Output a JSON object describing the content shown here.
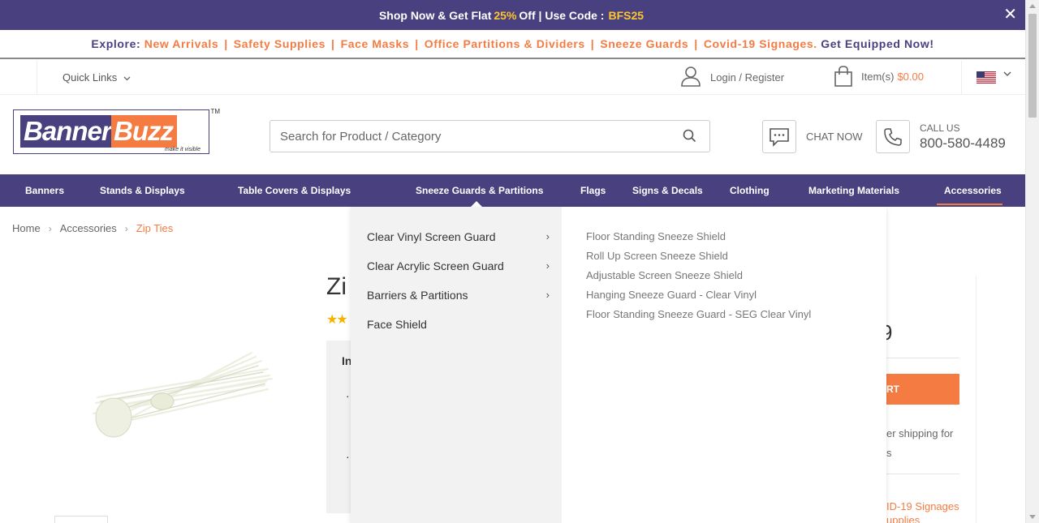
{
  "promo": {
    "prefix": "Shop Now & Get Flat",
    "percent": "25%",
    "middle": "Off | Use Code :",
    "code": "BFS25",
    "close": "✕"
  },
  "explore": {
    "label": "Explore:",
    "links": [
      "New Arrivals",
      "Safety Supplies",
      "Face Masks",
      "Office Partitions & Dividers",
      "Sneeze Guards",
      "Covid-19 Signages"
    ],
    "separator": "|",
    "dot": ".",
    "cta": "Get Equipped Now!"
  },
  "util": {
    "quick_links": "Quick Links",
    "login": "Login / Register",
    "cart_label": "Item(s)",
    "cart_amount": "$0.00"
  },
  "header": {
    "logo_part1": "Banner",
    "logo_part2": "Buzz",
    "logo_tagline": "make it visible",
    "logo_tm": "TM",
    "search_placeholder": "Search for Product / Category",
    "chat_label": "CHAT NOW",
    "call_label": "CALL US",
    "call_number": "800-580-4489"
  },
  "nav": {
    "items": [
      "Banners",
      "Stands & Displays",
      "Table Covers & Displays",
      "Sneeze Guards & Partitions",
      "Flags",
      "Signs & Decals",
      "Clothing",
      "Marketing Materials",
      "Accessories"
    ]
  },
  "breadcrumb": {
    "items": [
      "Home",
      "Accessories",
      "Zip Ties"
    ],
    "sep": "›"
  },
  "product": {
    "title_fragment": "Zi",
    "stars": "★★",
    "info_fragment": "In",
    "bullet": "·",
    "price_fragment": "9",
    "cart_fragment": "RT",
    "shipping_fragment1": "er shipping for",
    "shipping_fragment2": "s",
    "covid_fragment1": "ID-19 Signages",
    "covid_fragment2": "upplies"
  },
  "mega_menu": {
    "sub_categories": [
      {
        "label": "Clear Vinyl Screen Guard",
        "has_children": true
      },
      {
        "label": "Clear Acrylic Screen Guard",
        "has_children": true
      },
      {
        "label": "Barriers & Partitions",
        "has_children": true
      },
      {
        "label": "Face Shield",
        "has_children": false
      }
    ],
    "links": [
      "Floor Standing Sneeze Shield",
      "Roll Up Screen Sneeze Shield",
      "Adjustable Screen Sneeze Shield",
      "Hanging Sneeze Guard - Clear Vinyl",
      "Floor Standing Sneeze Guard - SEG Clear Vinyl"
    ],
    "chevron": "›"
  },
  "colors": {
    "brand_purple": "#48407f",
    "brand_orange": "#f47c42",
    "promo_highlight": "#ffc52f"
  }
}
